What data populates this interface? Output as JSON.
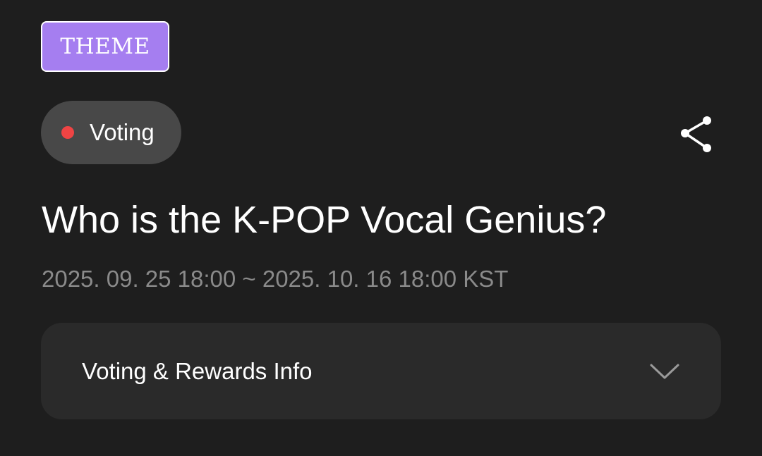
{
  "badge": {
    "label": "THEME",
    "color": "#a57ef0"
  },
  "status": {
    "label": "Voting",
    "dot_color": "#ef4444",
    "icon": "live-dot-icon"
  },
  "share": {
    "icon": "share-icon"
  },
  "vote": {
    "title": "Who is the K-POP Vocal Genius?",
    "period": "2025. 09. 25 18:00 ~ 2025. 10. 16 18:00 KST"
  },
  "info_panel": {
    "label": "Voting & Rewards Info",
    "icon": "chevron-down-icon",
    "expanded": false
  },
  "colors": {
    "background": "#1e1e1e",
    "panel": "#2a2a2a",
    "pill": "#484848",
    "muted_text": "#8a8a8a"
  }
}
